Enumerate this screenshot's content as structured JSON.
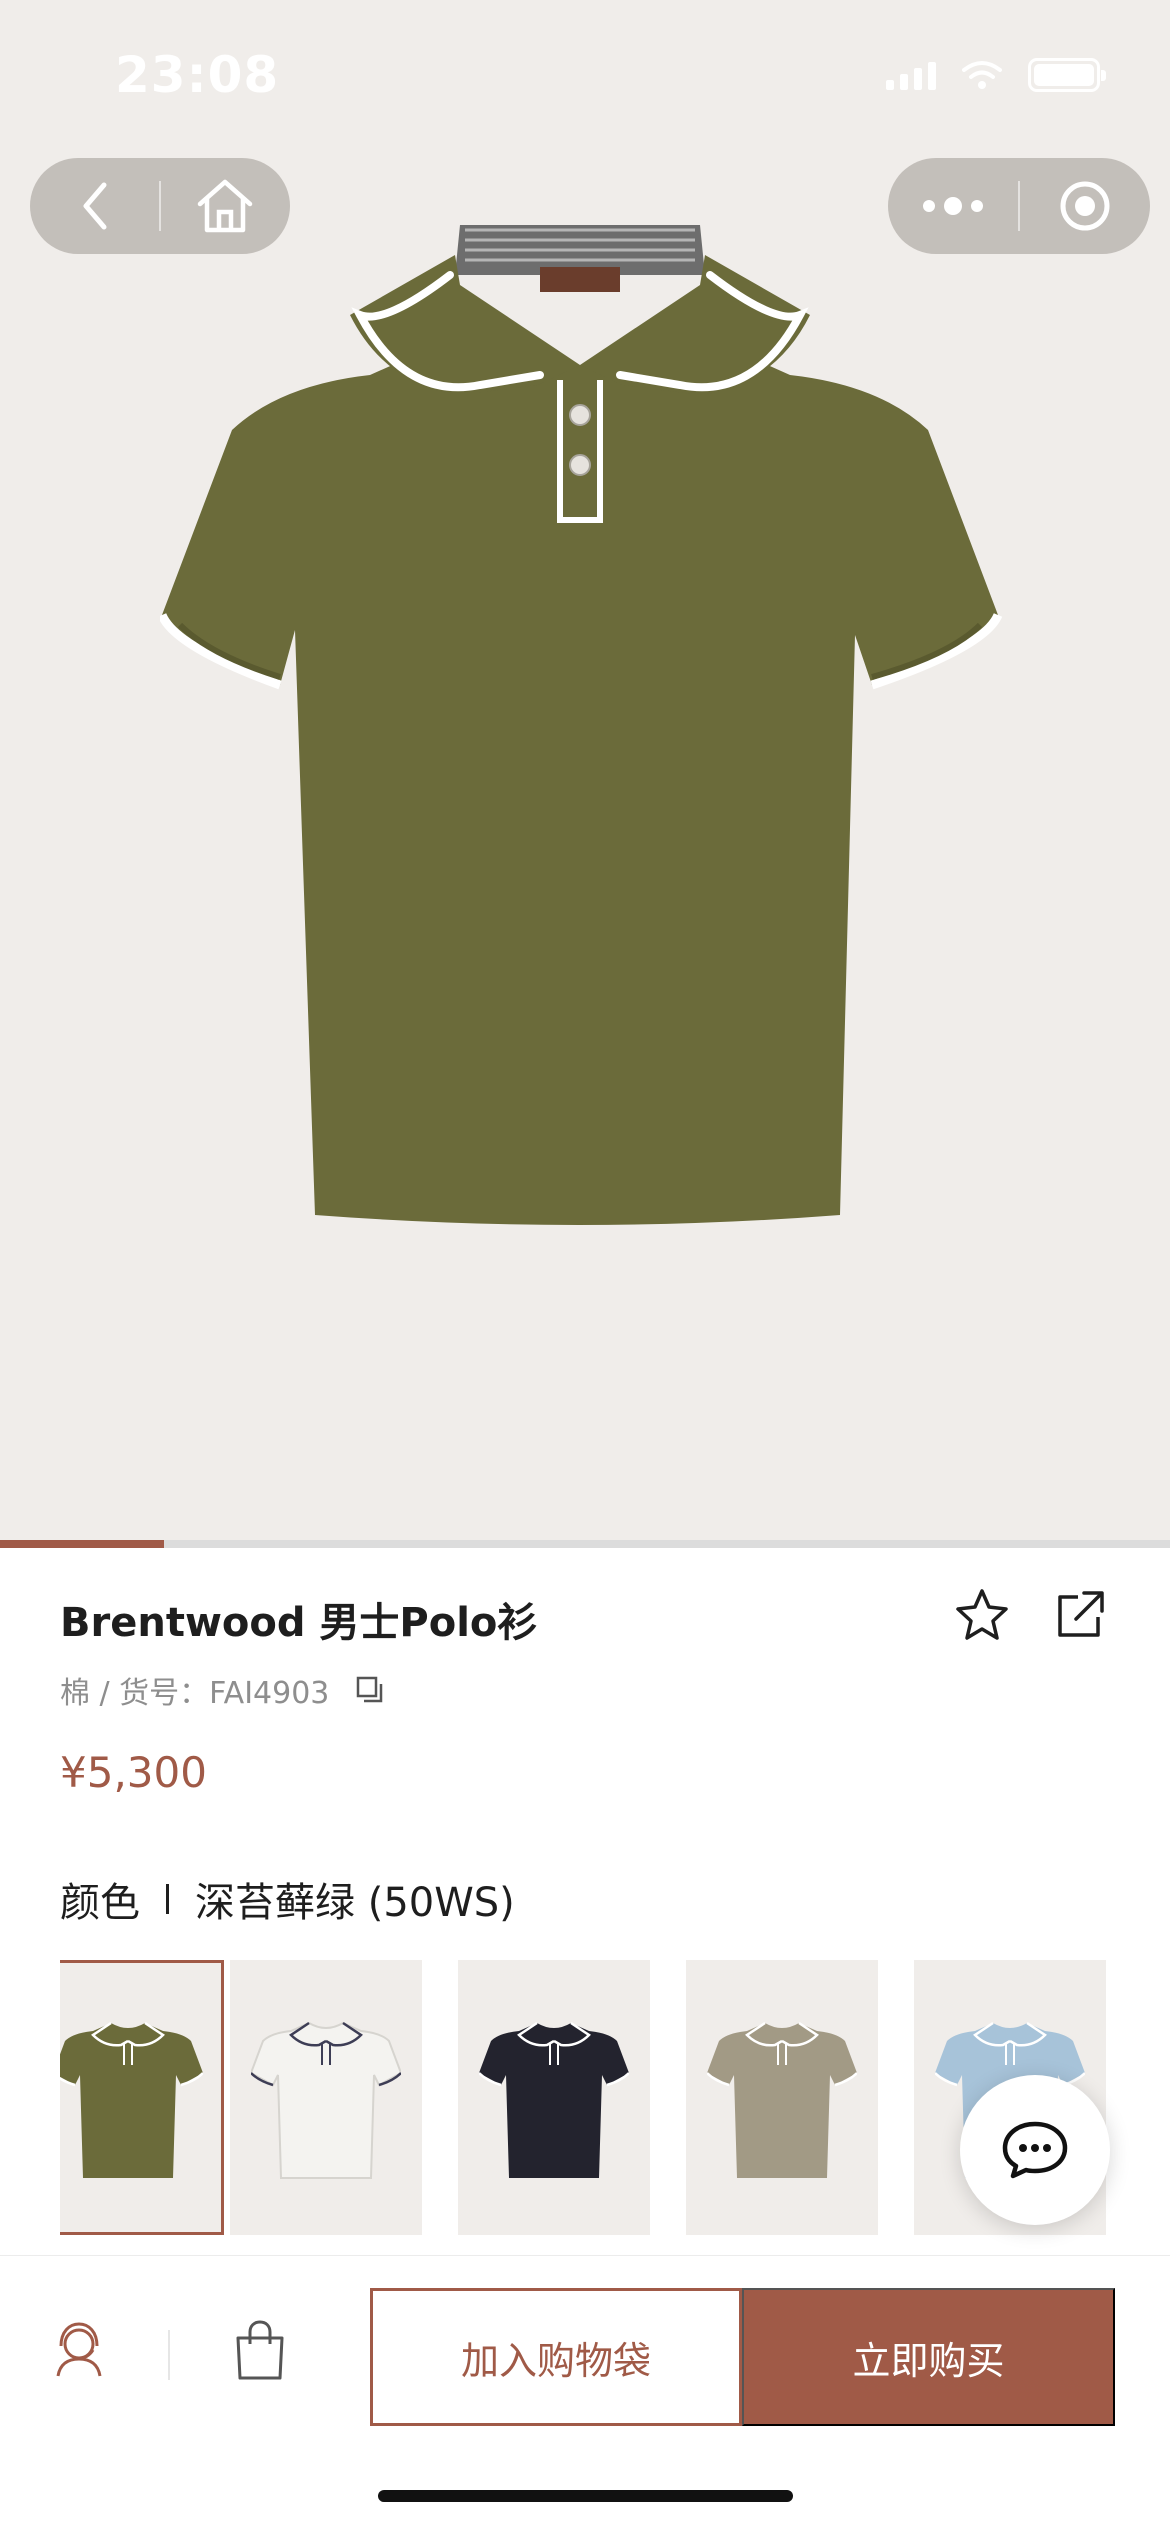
{
  "status_bar": {
    "time": "23:08"
  },
  "nav": {
    "back_icon": "chevron-left-icon",
    "home_icon": "home-icon",
    "more_icon": "more-dots-icon",
    "close_icon": "target-circle-icon"
  },
  "gallery": {
    "progress_fraction": 0.14,
    "main_color": "#6b6b3a"
  },
  "product": {
    "title": "Brentwood 男士Polo衫",
    "meta": "棉 / 货号：FAI4903",
    "price": "¥5,300",
    "favorite_icon": "star-icon",
    "share_icon": "share-icon",
    "copy_icon": "copy-icon"
  },
  "color": {
    "label": "颜色",
    "selected": "深苔藓绿 (50WS)",
    "swatches": [
      {
        "color": "#6b6b3a",
        "selected": true
      },
      {
        "color": "#f4f3f0",
        "selected": false
      },
      {
        "color": "#23232e",
        "selected": false
      },
      {
        "color": "#a29a85",
        "selected": false
      },
      {
        "color": "#a7c3d9",
        "selected": false
      }
    ]
  },
  "chat": {
    "icon": "chat-bubble-icon"
  },
  "actions": {
    "service_icon": "customer-service-icon",
    "bag_icon": "shopping-bag-icon",
    "add_to_bag": "加入购物袋",
    "buy_now": "立即购买"
  },
  "colors": {
    "accent": "#a05a47",
    "hero_bg": "#f0edea"
  }
}
